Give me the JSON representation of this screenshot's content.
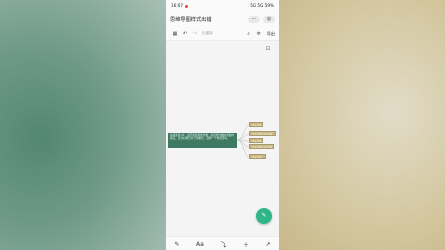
{
  "status_bar": {
    "time": "16:07",
    "signal_text": "5G 5G",
    "battery": "59%"
  },
  "titlebar": {
    "title": "思维导图样式出错"
  },
  "toolbar": {
    "saved_text": "已保存",
    "export_label": "导出"
  },
  "mindmap": {
    "root_text": "在描述第1步，展开新建思维导图，在思维导图中添加内容后，点击右侧分支下的格式，选择一个样式即可。",
    "children": [
      "分支主题",
      "分支主题 分支主题",
      "分支主题",
      "分支主题 分支主题",
      "分支主题"
    ]
  },
  "fab": {
    "label": "✎"
  },
  "bottom_bar": {
    "items": [
      "✎",
      "Aa",
      "⤵",
      "＋",
      "↗"
    ]
  },
  "icons": {
    "more": "more-icon",
    "settings": "settings-icon",
    "calendar": "calendar-icon",
    "undo": "undo-icon",
    "redo": "redo-icon",
    "search": "search-icon",
    "settings2": "gear-icon"
  }
}
